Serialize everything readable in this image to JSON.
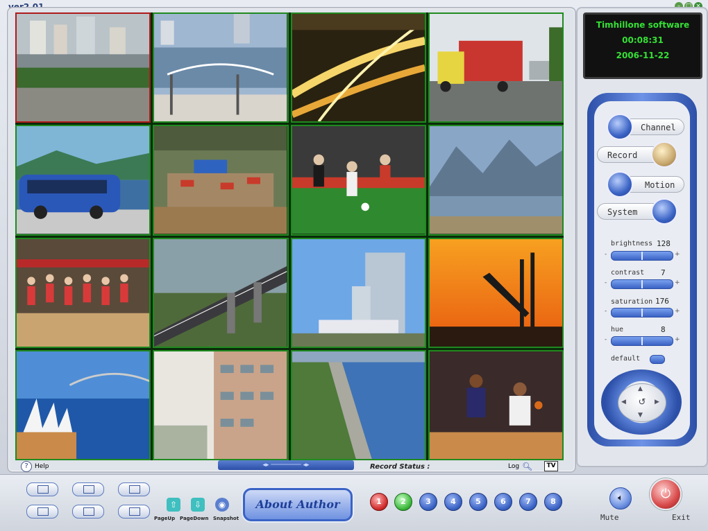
{
  "app": {
    "version": "ver2.01"
  },
  "lcd": {
    "company": "Timhillone software",
    "time": "00:08:31",
    "date": "2006-11-22"
  },
  "controls": {
    "channel": "Channel",
    "record": "Record",
    "motion": "Motion",
    "system": "System",
    "brightness": {
      "label": "brightness",
      "value": "128"
    },
    "contrast": {
      "label": "contrast",
      "value": "7"
    },
    "saturation": {
      "label": "saturation",
      "value": "176"
    },
    "hue": {
      "label": "hue",
      "value": "8"
    },
    "default": "default"
  },
  "status": {
    "help": "Help",
    "record_status": "Record Status :",
    "log": "Log",
    "tv": "TV"
  },
  "bottom": {
    "pageup": "PageUp",
    "pagedown": "PageDown",
    "snapshot": "Snapshot",
    "about": "About Author",
    "channels": [
      "1",
      "2",
      "3",
      "4",
      "5",
      "6",
      "7",
      "8"
    ],
    "mute": "Mute",
    "exit": "Exit"
  },
  "colors": {
    "accent": "#3a63c5",
    "lcd_text": "#35e035",
    "cell_border": "#1f8a1f",
    "selected_border": "#b01a1a"
  }
}
